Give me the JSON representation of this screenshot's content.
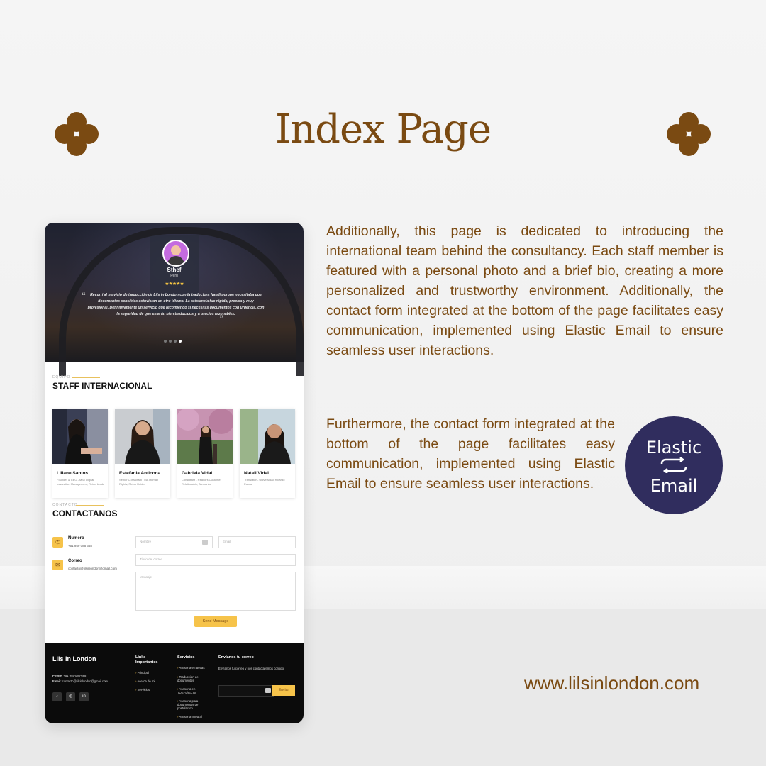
{
  "title": "Index Page",
  "paragraph1": "Additionally, this page is dedicated to introducing the international team behind the consultancy. Each staff member is featured with a personal photo and a brief bio, creating a more personalized and trustworthy environment. Additionally, the contact form integrated at the bottom of the page facilitates easy communication, implemented using Elastic Email to ensure seamless user interactions.",
  "paragraph2": "Furthermore, the contact form integrated at the bottom of the page facilitates easy communication, implemented using Elastic Email to ensure seamless user interactions.",
  "elastic_logo": {
    "line1": "Elastic",
    "line2": "Email",
    "bg_color": "#302d5e"
  },
  "website_url": "www.lilsinlondon.com",
  "colors": {
    "accent_brown": "#7a4a12",
    "accent_yellow": "#f6c34a"
  },
  "screenshot": {
    "hero": {
      "reviewer_name": "Sthef",
      "reviewer_country": "Peru",
      "stars": "★★★★★",
      "quote": "Recurrí al servicio de traducción de Lils in London con la traductora Natali porque necesitaba que documentos sensibles estuvieran en otro idioma. La asistencia fue rápida, precisa y muy profesional. Definitivamente un servicio que recomiendo si necesitas documentos con urgencia, con la seguridad de que estarán bien traducidos y a precios razonables."
    },
    "staff_section": {
      "kicker": "EQUIPO",
      "title": "STAFF INTERNACIONAL",
      "members": [
        {
          "name": "Liliane Santos",
          "role": "Founder & CEO - MSc Digital Innovation Management, Reino Unido"
        },
        {
          "name": "Estefania Anticona",
          "role": "Senior Consultant - MA Human Rights, Reino Unido"
        },
        {
          "name": "Gabriela Vidal",
          "role": "Consultant - Realtors Customer Relationship, Alemania"
        },
        {
          "name": "Natali Vidal",
          "role": "Translator - Universidad Ricardo Palma"
        }
      ]
    },
    "contact_section": {
      "kicker": "CONTACTO",
      "title": "CONTACTANOS",
      "phone_label": "Numero",
      "phone_value": "+51 949 086 668",
      "email_label": "Correo",
      "email_value": "contacto@lilsinlondon@gmail.com",
      "placeholder_name": "Nombre",
      "placeholder_email": "Email",
      "placeholder_subject": "Titulo del correo",
      "placeholder_message": "Mensaje",
      "send_label": "Send Message"
    },
    "footer": {
      "brand": "Lils in London",
      "phone_label": "Phone:",
      "phone": "+51 949-086-668",
      "email_label": "Email:",
      "email": "contacto@lilsinlondon@gmail.com",
      "links_title": "Links Importantes",
      "links": [
        "Principal",
        "Acerca de mi",
        "Servicios"
      ],
      "services_title": "Servicios",
      "services": [
        "Asesoría en Becas",
        "Traduccion de documentos",
        "Asesoría en TOEFL/IELTS",
        "Asesoría para documentos de postulacion",
        "Asesoría Integral"
      ],
      "newsletter_title": "Envíanos tu correo",
      "newsletter_text": "Envíanos tu correo y nos contactaremos contigo!",
      "newsletter_button": "Enviar"
    }
  }
}
